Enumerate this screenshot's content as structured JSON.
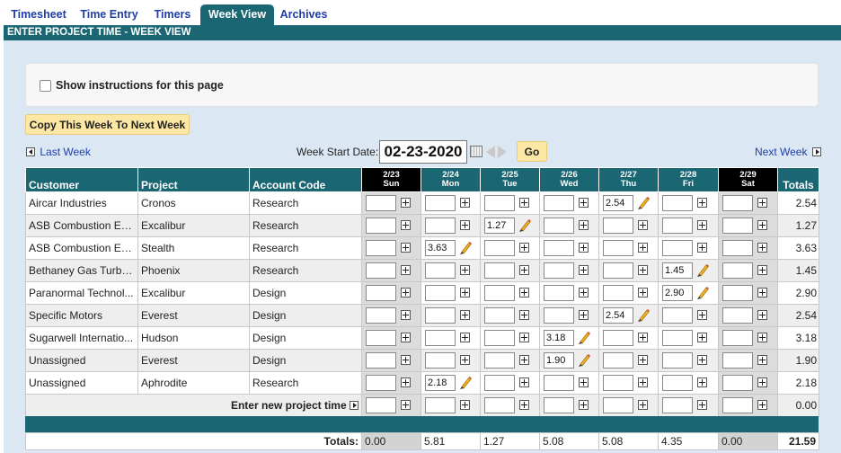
{
  "tabs": [
    {
      "label": "Timesheet",
      "active": false
    },
    {
      "label": "Time Entry",
      "active": false
    },
    {
      "label": "Timers",
      "active": false
    },
    {
      "label": "Week View",
      "active": true
    },
    {
      "label": "Archives",
      "active": false
    }
  ],
  "page_title": "ENTER PROJECT TIME - WEEK VIEW",
  "instructions_label": "Show instructions for this page",
  "copy_week_button": "Copy This Week To Next Week",
  "nav": {
    "last_week": "Last Week",
    "next_week": "Next Week",
    "week_start_label": "Week Start Date:",
    "week_start_value": "02-23-2020",
    "go_label": "Go"
  },
  "columns": {
    "customer": "Customer",
    "project": "Project",
    "account_code": "Account Code",
    "totals": "Totals"
  },
  "days": [
    {
      "date": "2/23",
      "day": "Sun",
      "weekend": true
    },
    {
      "date": "2/24",
      "day": "Mon",
      "weekend": false
    },
    {
      "date": "2/25",
      "day": "Tue",
      "weekend": false
    },
    {
      "date": "2/26",
      "day": "Wed",
      "weekend": false
    },
    {
      "date": "2/27",
      "day": "Thu",
      "weekend": false
    },
    {
      "date": "2/28",
      "day": "Fri",
      "weekend": false
    },
    {
      "date": "2/29",
      "day": "Sat",
      "weekend": true
    }
  ],
  "rows": [
    {
      "customer": "Aircar Industries",
      "project": "Cronos",
      "account": "Research",
      "hours": [
        "",
        "",
        "",
        "",
        "2.54",
        "",
        ""
      ],
      "total": "2.54"
    },
    {
      "customer": "ASB Combustion En...",
      "project": "Excalibur",
      "account": "Research",
      "hours": [
        "",
        "",
        "1.27",
        "",
        "",
        "",
        ""
      ],
      "total": "1.27"
    },
    {
      "customer": "ASB Combustion En...",
      "project": "Stealth",
      "account": "Research",
      "hours": [
        "",
        "3.63",
        "",
        "",
        "",
        "",
        ""
      ],
      "total": "3.63"
    },
    {
      "customer": "Bethaney Gas Turbine",
      "project": "Phoenix",
      "account": "Research",
      "hours": [
        "",
        "",
        "",
        "",
        "",
        "1.45",
        ""
      ],
      "total": "1.45"
    },
    {
      "customer": "Paranormal Technol...",
      "project": "Excalibur",
      "account": "Design",
      "hours": [
        "",
        "",
        "",
        "",
        "",
        "2.90",
        ""
      ],
      "total": "2.90"
    },
    {
      "customer": "Specific Motors",
      "project": "Everest",
      "account": "Design",
      "hours": [
        "",
        "",
        "",
        "",
        "2.54",
        "",
        ""
      ],
      "total": "2.54"
    },
    {
      "customer": "Sugarwell Internatio...",
      "project": "Hudson",
      "account": "Design",
      "hours": [
        "",
        "",
        "",
        "3.18",
        "",
        "",
        ""
      ],
      "total": "3.18"
    },
    {
      "customer": "Unassigned",
      "project": "Everest",
      "account": "Design",
      "hours": [
        "",
        "",
        "",
        "1.90",
        "",
        "",
        ""
      ],
      "total": "1.90"
    },
    {
      "customer": "Unassigned",
      "project": "Aphrodite",
      "account": "Research",
      "hours": [
        "",
        "2.18",
        "",
        "",
        "",
        "",
        ""
      ],
      "total": "2.18"
    }
  ],
  "new_project_label": "Enter new project time",
  "new_project_total": "0.00",
  "totals_label": "Totals:",
  "day_totals": [
    "0.00",
    "5.81",
    "1.27",
    "5.08",
    "5.08",
    "4.35",
    "0.00"
  ],
  "grand_total": "21.59"
}
